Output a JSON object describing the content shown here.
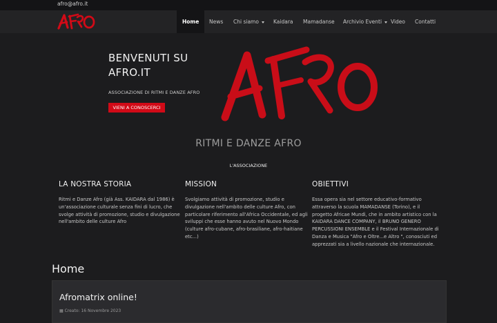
{
  "topbar": {
    "email": "afro@afro.it"
  },
  "nav": {
    "logo_text": "AFRO",
    "items": [
      {
        "label": "Home"
      },
      {
        "label": "News"
      },
      {
        "label": "Chi siamo"
      },
      {
        "label": "Kaidara"
      },
      {
        "label": "Mamadanse"
      },
      {
        "label": "Archivio Eventi"
      },
      {
        "label": "Video"
      },
      {
        "label": "Contatti"
      }
    ]
  },
  "hero": {
    "title_line1": "BENVENUTI SU",
    "title_line2": "AFRO.IT",
    "subtitle": "ASSOCIAZIONE DI RITMI E DANZE AFRO",
    "button": "VIENI A CONOSCERCI",
    "logo_text": "AFRO"
  },
  "section": {
    "title": "RITMI E DANZE AFRO",
    "subtitle": "L'ASSOCIAZIONE"
  },
  "columns": [
    {
      "title": "LA NOSTRA STORIA",
      "text": "Ritmi e Danze Afro (già Ass. KAIDARA dal 1986) è un'associazione culturale senza fini di lucro, che svolge attività di promozione, studio e divulgazione nell'ambito delle culture Afro"
    },
    {
      "title": "MISSION",
      "text": "Svolgiamo attività di promozione, studio e divulgazione nell'ambito delle culture Afro, con particolare riferimento all'Africa Occidentale, ed agli sviluppi che esse hanno avuto nel Nuovo Mondo (culture afro-cubane, afro-brasiliane, afro-haitiane etc...)"
    },
    {
      "title": "OBIETTIVI",
      "text": "Essa opera sia nel settore educativo-formativo attraverso la scuola MAMADANSE (Torino), e il progetto Africae Mundi, che in ambito artistico con la KAIDARA DANCE COMPANY, il BRUNO GENERO PERCUSSIONI ENSEMBLE e il Festival Internazionale di Danza e Musica \"Afro e Oltre...e Altro \", conosciuti ed apprezzati sia a livello nazionale che internazionale."
    }
  ],
  "home": {
    "title": "Home",
    "card_title": "Afromatrix online!",
    "card_meta": "Creato: 16 Novembre 2023"
  },
  "colors": {
    "accent": "#d10a17",
    "background": "#1c1c1e",
    "navbar": "#232325"
  }
}
